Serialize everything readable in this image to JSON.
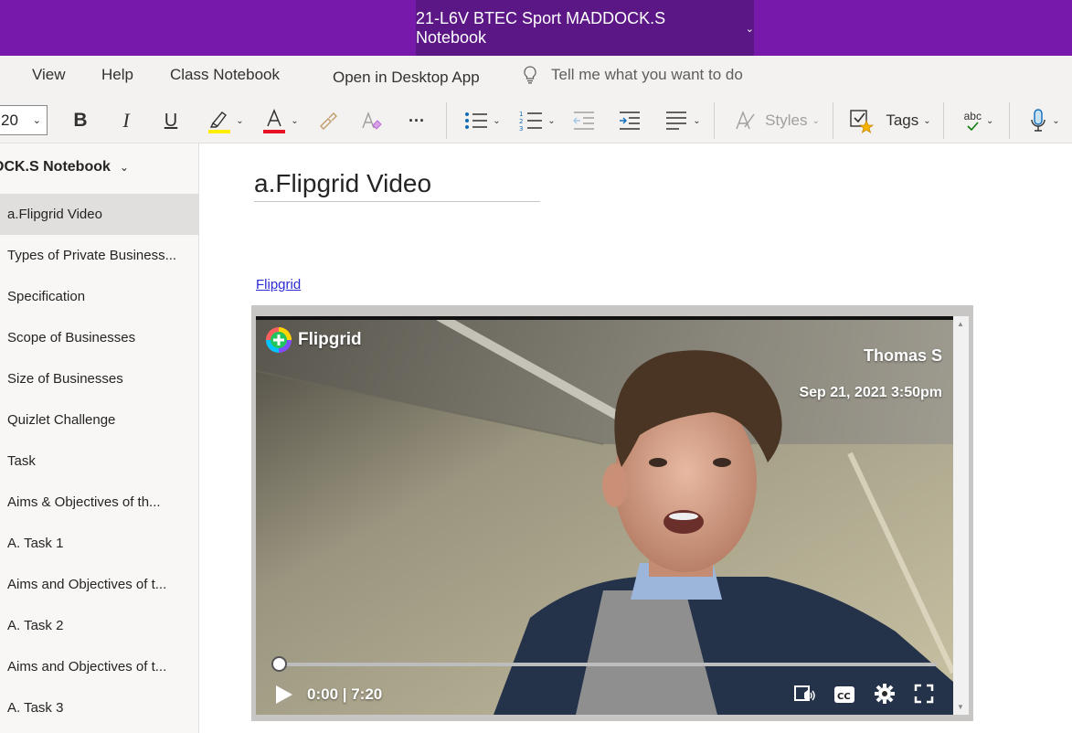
{
  "titlebar": {
    "notebook_title": "21-L6V BTEC Sport MADDOCK.S Notebook"
  },
  "menu": {
    "view": "View",
    "help": "Help",
    "class_notebook": "Class Notebook",
    "open_desktop": "Open in Desktop App",
    "tell_me": "Tell me what you want to do"
  },
  "ribbon": {
    "font_size": "20",
    "bold": "B",
    "italic": "I",
    "underline": "U",
    "more": "···",
    "styles": "Styles",
    "tags": "Tags",
    "spell": "abc"
  },
  "colors": {
    "brand": "#7719aa",
    "brand_dark": "#5c1786",
    "highlight": "#ffee00",
    "font_color": "#e81123"
  },
  "sidebar": {
    "section_title": "OCK.S Notebook",
    "pages": [
      "a.Flipgrid Video",
      "Types of Private Business...",
      "Specification",
      "Scope of Businesses",
      "Size of Businesses",
      "Quizlet Challenge",
      "Task",
      "Aims & Objectives of th...",
      "A. Task 1",
      "Aims and Objectives of t...",
      "A. Task 2",
      "Aims and Objectives of t...",
      "A. Task 3"
    ]
  },
  "content": {
    "page_title": "a.Flipgrid Video",
    "link_text": "Flipgrid",
    "video": {
      "brand": "Flipgrid",
      "author": "Thomas S",
      "date": "Sep 21, 2021 3:50pm",
      "time": "0:00 | 7:20",
      "progress": 0
    }
  }
}
